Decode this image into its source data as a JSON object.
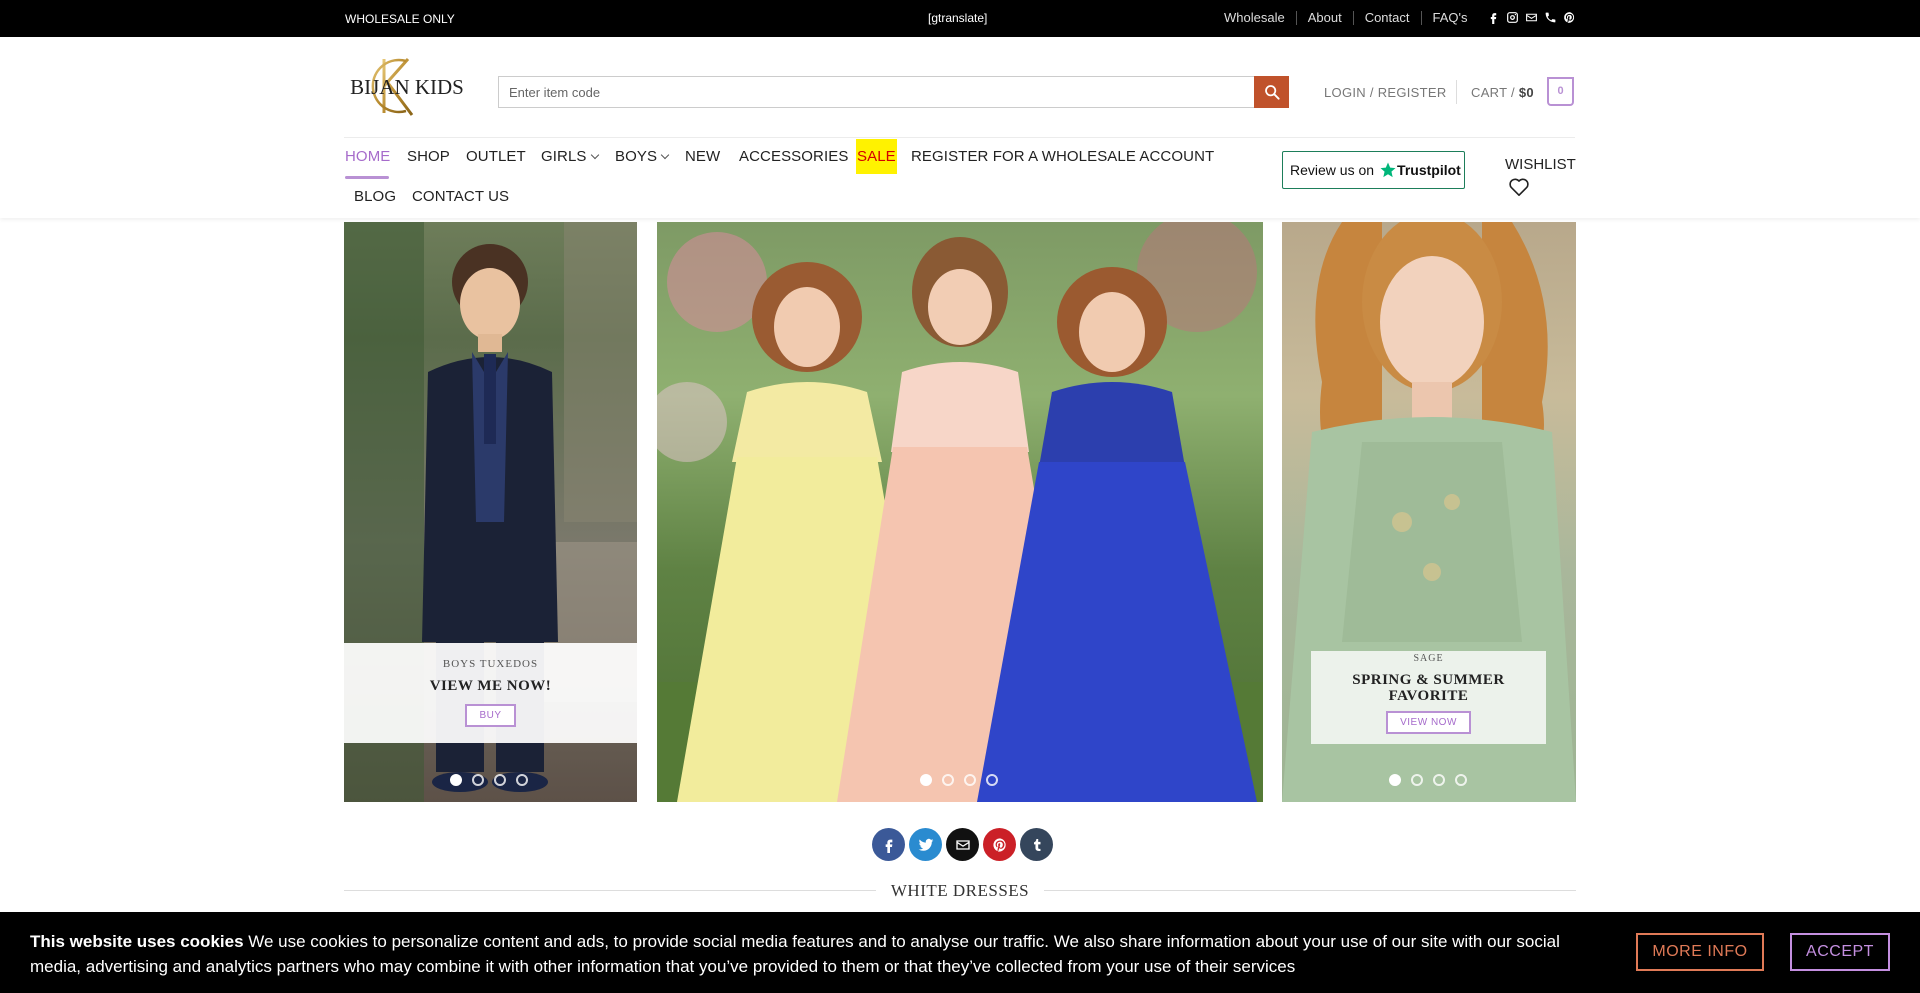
{
  "topbar": {
    "left_text": "WHOLESALE ONLY",
    "center_text": "[gtranslate]",
    "links": [
      "Wholesale",
      "About",
      "Contact",
      "FAQ's"
    ],
    "social_icons": [
      "facebook-icon",
      "instagram-icon",
      "email-icon",
      "phone-icon",
      "pinterest-icon"
    ]
  },
  "header": {
    "logo_text": "BIJAN KIDS",
    "search_placeholder": "Enter item code",
    "login_label": "LOGIN / REGISTER",
    "cart_label": "CART /",
    "cart_amount": "$0",
    "cart_count": "0",
    "wishlist_label": "WISHLIST",
    "trustpilot_prefix": "Review us on",
    "trustpilot_brand": "Trustpilot"
  },
  "nav": {
    "items": [
      "HOME",
      "SHOP",
      "OUTLET",
      "GIRLS",
      "BOYS",
      "NEW",
      "ACCESSORIES",
      "SALE",
      "REGISTER FOR A WHOLESALE ACCOUNT",
      "BLOG",
      "CONTACT US"
    ],
    "active": "HOME"
  },
  "banners": {
    "left": {
      "subtitle": "BOYS TUXEDOS",
      "title": "VIEW ME NOW!",
      "button": "BUY"
    },
    "right": {
      "subtitle": "SAGE",
      "title_line1": "SPRING & SUMMER",
      "title_line2": "FAVORITE",
      "button": "VIEW NOW"
    }
  },
  "share_icons": [
    "facebook-icon",
    "twitter-icon",
    "email-icon",
    "pinterest-icon",
    "tumblr-icon"
  ],
  "section_title": "WHITE DRESSES",
  "cookie": {
    "bold": "This website uses cookies",
    "text": " We use cookies to personalize content and ads, to provide social media features and to analyse our traffic. We also share information about your use of our site with our social media, advertising and analytics partners who may combine it with other information that you’ve provided to them or that they’ve collected from your use of their services",
    "more_label": "MORE INFO",
    "accept_label": "ACCEPT"
  },
  "colors": {
    "accent": "#b991d4",
    "search_button": "#c0522b",
    "sale_bg": "#fff200",
    "sale_text": "#d40000",
    "more_info": "#e07a57"
  }
}
